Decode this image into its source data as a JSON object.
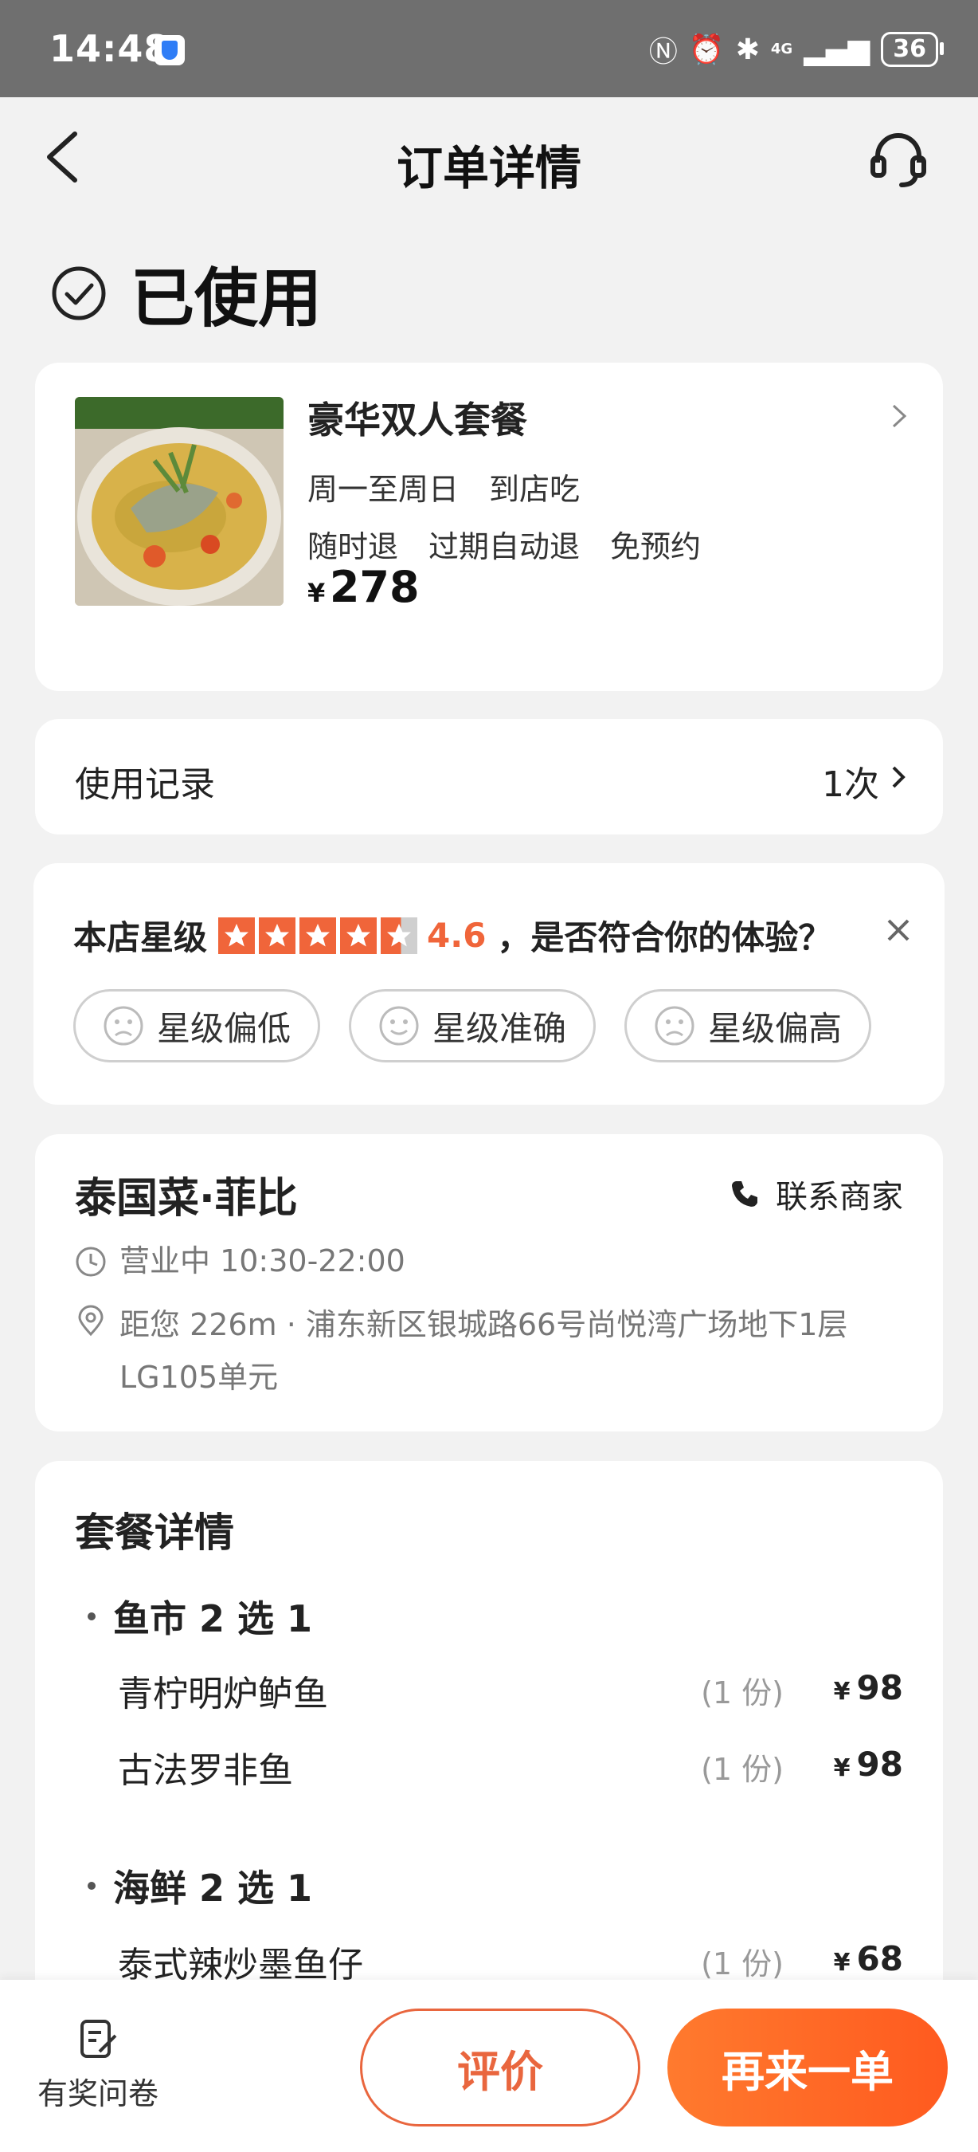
{
  "status_bar": {
    "time": "14:48",
    "battery": "36",
    "network": "4G"
  },
  "nav": {
    "title": "订单详情"
  },
  "order_status": "已使用",
  "product": {
    "name": "豪华双人套餐",
    "line1": "周一至周日　到店吃",
    "line2": "随时退　过期自动退　免预约",
    "currency": "¥",
    "price": "278"
  },
  "usage": {
    "label": "使用记录",
    "value": "1次"
  },
  "rating": {
    "label": "本店星级",
    "stars": 4.6,
    "score": "4.6",
    "question": "，是否符合你的体验？",
    "options": [
      "星级偏低",
      "星级准确",
      "星级偏高"
    ]
  },
  "store": {
    "name": "泰国菜·菲比",
    "contact": "联系商家",
    "hours": "营业中 10:30-22:00",
    "address": "距您 226m · 浦东新区银城路66号尚悦湾广场地下1层LG105单元"
  },
  "package": {
    "title": "套餐详情",
    "groups": [
      {
        "name": "鱼市 2 选 1",
        "items": [
          {
            "name": "青柠明炉鲈鱼",
            "qty": "(1 份)",
            "price": "98"
          },
          {
            "name": "古法罗非鱼",
            "qty": "(1 份)",
            "price": "98"
          }
        ]
      },
      {
        "name": "海鲜 2 选 1",
        "items": [
          {
            "name": "泰式辣炒墨鱼仔",
            "qty": "(1 份)",
            "price": "68"
          }
        ]
      }
    ]
  },
  "bottom": {
    "survey": "有奖问卷",
    "review": "评价",
    "reorder": "再来一单"
  }
}
